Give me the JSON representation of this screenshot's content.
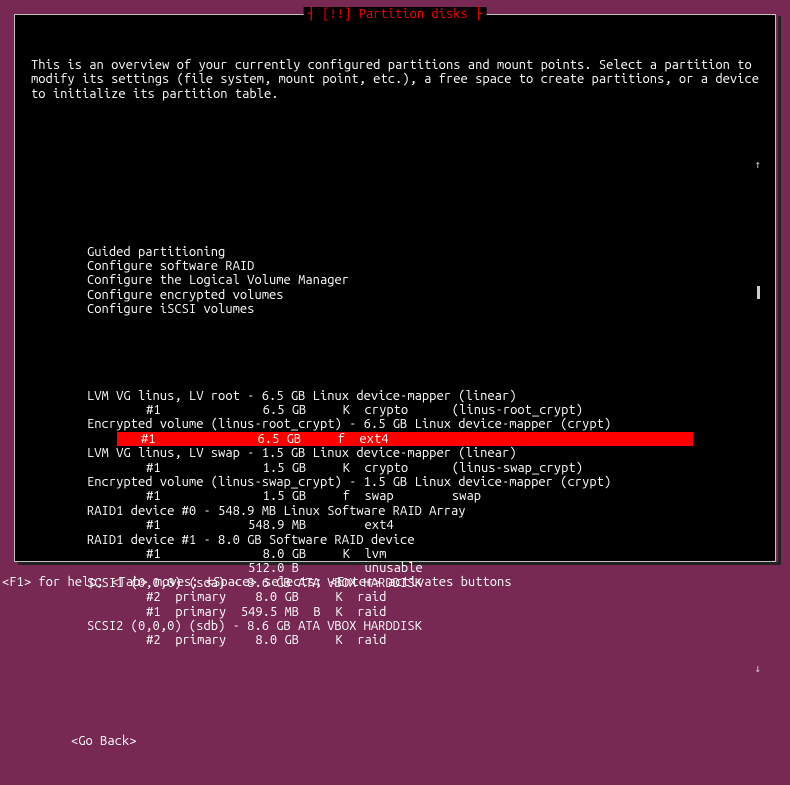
{
  "title": "┤ [!!] Partition disks ├",
  "intro": "This is an overview of your currently configured partitions and mount points. Select a partition to modify its settings (file system, mount point, etc.), a free space to create partitions, or a device to initialize its partition table.",
  "menu": {
    "top": [
      "Guided partitioning",
      "Configure software RAID",
      "Configure the Logical Volume Manager",
      "Configure encrypted volumes",
      "Configure iSCSI volumes"
    ],
    "rows": [
      {
        "txt": "LVM VG linus, LV root - 6.5 GB Linux device-mapper (linear)",
        "lvl": 1
      },
      {
        "txt": "    #1              6.5 GB     K  crypto      (linus-root_crypt)",
        "lvl": 2
      },
      {
        "txt": "Encrypted volume (linus-root_crypt) - 6.5 GB Linux device-mapper (crypt)",
        "lvl": 1
      },
      {
        "txt": "#1              6.5 GB     f  ext4",
        "lvl": 2,
        "sel": true
      },
      {
        "txt": "LVM VG linus, LV swap - 1.5 GB Linux device-mapper (linear)",
        "lvl": 1
      },
      {
        "txt": "    #1              1.5 GB     K  crypto      (linus-swap_crypt)",
        "lvl": 2
      },
      {
        "txt": "Encrypted volume (linus-swap_crypt) - 1.5 GB Linux device-mapper (crypt)",
        "lvl": 1
      },
      {
        "txt": "    #1              1.5 GB     f  swap        swap",
        "lvl": 2
      },
      {
        "txt": "RAID1 device #0 - 548.9 MB Linux Software RAID Array",
        "lvl": 1
      },
      {
        "txt": "    #1            548.9 MB        ext4",
        "lvl": 2
      },
      {
        "txt": "RAID1 device #1 - 8.0 GB Software RAID device",
        "lvl": 1
      },
      {
        "txt": "    #1              8.0 GB     K  lvm",
        "lvl": 2
      },
      {
        "txt": "                  512.0 B         unusable",
        "lvl": 2
      },
      {
        "txt": "SCSI1 (0,0,0) (sda) - 8.6 GB ATA VBOX HARDDISK",
        "lvl": 1
      },
      {
        "txt": "    #2  primary    8.0 GB     K  raid",
        "lvl": 2
      },
      {
        "txt": "    #1  primary  549.5 MB  B  K  raid",
        "lvl": 2
      },
      {
        "txt": "SCSI2 (0,0,0) (sdb) - 8.6 GB ATA VBOX HARDDISK",
        "lvl": 1
      },
      {
        "txt": "    #2  primary    8.0 GB     K  raid",
        "lvl": 2
      }
    ]
  },
  "goback": "<Go Back>",
  "helpbar": "<F1> for help; <Tab> moves; <Space> selects; <Enter> activates buttons",
  "scroll": {
    "up": "↑",
    "down": "↓"
  }
}
